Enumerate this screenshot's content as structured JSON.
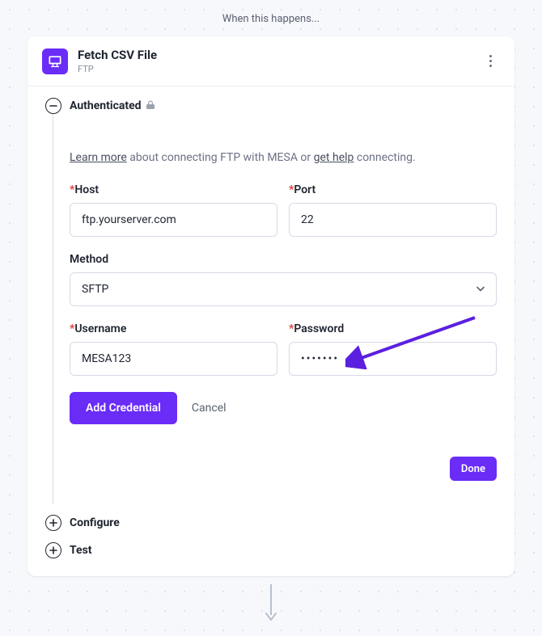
{
  "page": {
    "when_label": "When this happens..."
  },
  "header": {
    "title": "Fetch CSV File",
    "subtitle": "FTP"
  },
  "steps": {
    "authenticated": {
      "label": "Authenticated",
      "help_pre": "Learn more",
      "help_mid": " about connecting FTP with MESA or ",
      "help_link2": "get help",
      "help_post": " connecting.",
      "host_label": "Host",
      "host_value": "ftp.yourserver.com",
      "port_label": "Port",
      "port_value": "22",
      "method_label": "Method",
      "method_value": "SFTP",
      "username_label": "Username",
      "username_value": "MESA123",
      "password_label": "Password",
      "password_value": "•••••••",
      "add_credential_label": "Add Credential",
      "cancel_label": "Cancel",
      "done_label": "Done"
    },
    "configure": {
      "label": "Configure"
    },
    "test": {
      "label": "Test"
    }
  }
}
